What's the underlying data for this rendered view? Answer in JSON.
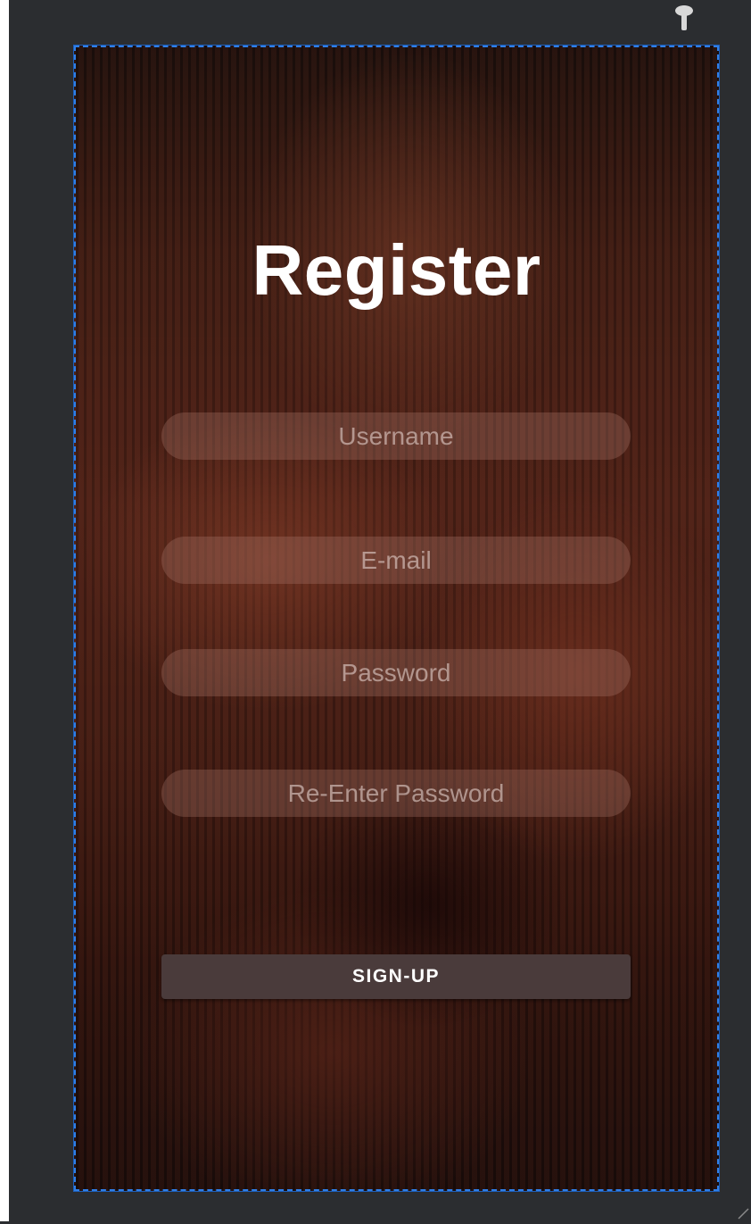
{
  "screen": {
    "title": "Register"
  },
  "form": {
    "username": {
      "value": "",
      "placeholder": "Username"
    },
    "email": {
      "value": "",
      "placeholder": "E-mail"
    },
    "password": {
      "value": "",
      "placeholder": "Password"
    },
    "re_password": {
      "value": "",
      "placeholder": "Re-Enter Password"
    },
    "submit_label": "SIGN-UP"
  },
  "colors": {
    "editor_background": "#2b2d30",
    "selection_outline": "#2f7fe8",
    "button_background": "#4a3b3b",
    "title_text": "#ffffff"
  },
  "icons": {
    "top_handle": "pin-icon",
    "corner_handle": "resize-handle-icon"
  }
}
